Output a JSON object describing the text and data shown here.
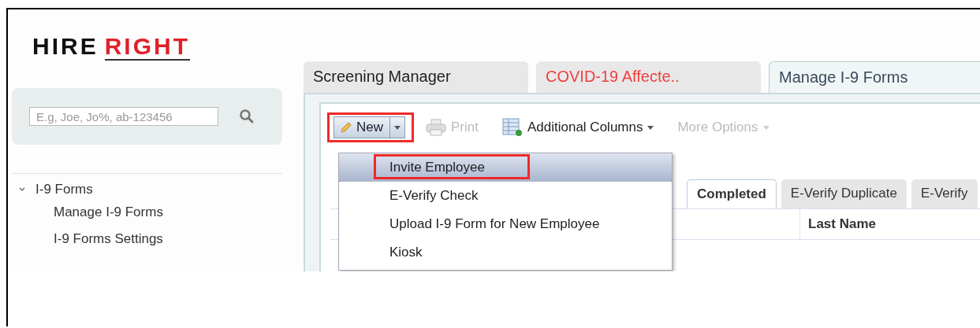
{
  "logo": {
    "word_1": "HIRE",
    "word_2": "RIGHT"
  },
  "search": {
    "placeholder": "E.g, Joe, Jo%, ab-123456"
  },
  "sidebar": {
    "items": [
      {
        "label": "I-9 Forms",
        "expanded": true,
        "children": [
          {
            "label": "Manage I-9 Forms"
          },
          {
            "label": "I-9 Forms Settings"
          }
        ]
      }
    ]
  },
  "tabs": [
    {
      "label": "Screening Manager",
      "selected": false,
      "alert": false
    },
    {
      "label": "COVID-19 Affecte..",
      "selected": false,
      "alert": true
    },
    {
      "label": "Manage I-9 Forms",
      "selected": true,
      "alert": false
    }
  ],
  "toolbar": [
    {
      "label": "New",
      "kind": "split",
      "disabled": false,
      "highlighted": true
    },
    {
      "label": "Print",
      "kind": "print",
      "disabled": true
    },
    {
      "label": "Additional Columns",
      "kind": "columns",
      "disabled": false
    },
    {
      "label": "More Options",
      "kind": "menu",
      "disabled": true
    }
  ],
  "subtabs": [
    {
      "label": "Completed",
      "selected": true
    },
    {
      "label": "E-Verify Duplicate",
      "selected": false
    },
    {
      "label": "E-Verify",
      "selected": false
    }
  ],
  "table": {
    "columns": [
      "Last Name"
    ]
  },
  "menu": {
    "items": [
      {
        "label": "Invite Employee",
        "selected": true,
        "highlighted": true
      },
      {
        "label": "E-Verify Check",
        "selected": false,
        "highlighted": false
      },
      {
        "label": "Upload I-9 Form for New Employee",
        "selected": false,
        "highlighted": false
      },
      {
        "label": "Kiosk",
        "selected": false,
        "highlighted": false
      }
    ]
  }
}
